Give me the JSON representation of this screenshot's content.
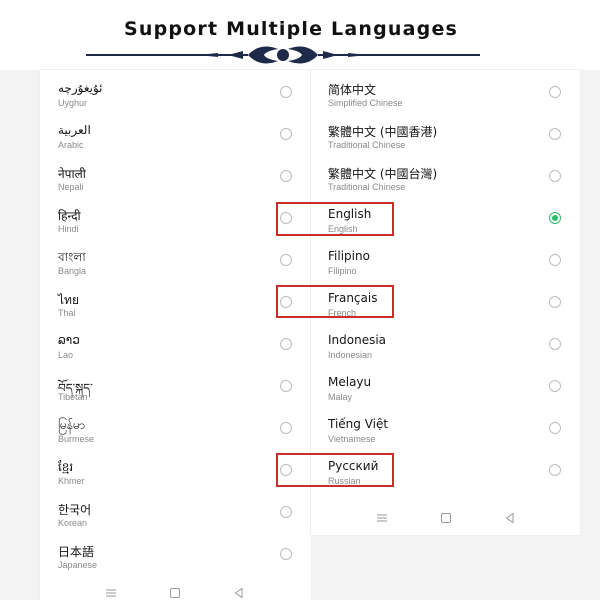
{
  "banner": {
    "title": "Support Multiple Languages"
  },
  "left_list": [
    {
      "native": "ئۇيغۇرچە",
      "english": "Uyghur",
      "selected": false
    },
    {
      "native": "العربية",
      "english": "Arabic",
      "selected": false
    },
    {
      "native": "नेपाली",
      "english": "Nepali",
      "selected": false
    },
    {
      "native": "हिन्दी",
      "english": "Hindi",
      "selected": false
    },
    {
      "native": "বাংলা",
      "english": "Bangla",
      "selected": false
    },
    {
      "native": "ไทย",
      "english": "Thai",
      "selected": false
    },
    {
      "native": "ລາວ",
      "english": "Lao",
      "selected": false
    },
    {
      "native": "བོད་སྐད་",
      "english": "Tibetan",
      "selected": false
    },
    {
      "native": "မြန်မာ",
      "english": "Burmese",
      "selected": false
    },
    {
      "native": "ខ្មែរ",
      "english": "Khmer",
      "selected": false
    },
    {
      "native": "한국어",
      "english": "Korean",
      "selected": false
    },
    {
      "native": "日本語",
      "english": "Japanese",
      "selected": false
    }
  ],
  "right_list": [
    {
      "native": "简体中文",
      "english": "Simplified Chinese",
      "selected": false
    },
    {
      "native": "繁體中文 (中國香港)",
      "english": "Traditional Chinese",
      "selected": false
    },
    {
      "native": "繁體中文 (中國台灣)",
      "english": "Traditional Chinese",
      "selected": false
    },
    {
      "native": "English",
      "english": "English",
      "selected": true
    },
    {
      "native": "Filipino",
      "english": "Filipino",
      "selected": false
    },
    {
      "native": "Français",
      "english": "French",
      "selected": false
    },
    {
      "native": "Indonesia",
      "english": "Indonesian",
      "selected": false
    },
    {
      "native": "Melayu",
      "english": "Malay",
      "selected": false
    },
    {
      "native": "Tiếng Việt",
      "english": "Vietnamese",
      "selected": false
    },
    {
      "native": "Русский",
      "english": "Russian",
      "selected": false
    }
  ],
  "icons": {
    "menu": "menu-icon",
    "home": "home-square-icon",
    "back": "back-triangle-icon",
    "radio": "radio-button-icon"
  },
  "colors": {
    "selected_radio": "#2ebd6b",
    "highlight_border": "#cc2c2c"
  }
}
